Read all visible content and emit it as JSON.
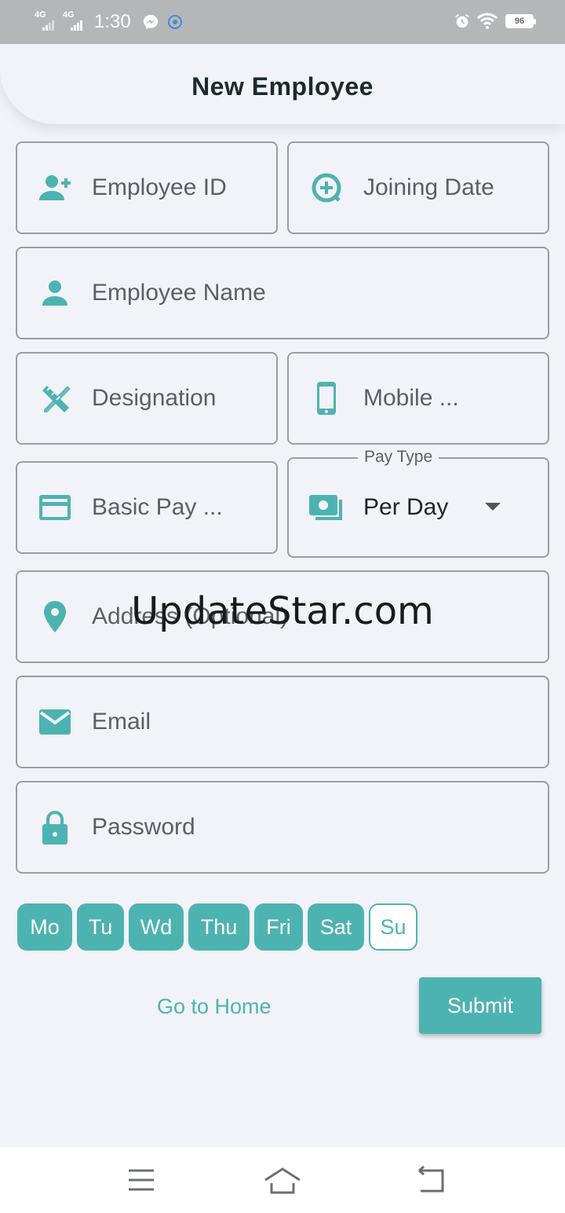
{
  "status_bar": {
    "network1": "4G",
    "network2": "4G",
    "time": "1:30",
    "battery": "96",
    "icons": [
      "messenger-icon",
      "notification-icon",
      "alarm-icon",
      "wifi-icon"
    ]
  },
  "header": {
    "title": "New Employee"
  },
  "fields": {
    "employee_id": {
      "label": "Employee ID",
      "icon": "person-add-icon"
    },
    "joining_date": {
      "label": "Joining Date",
      "icon": "date-add-icon"
    },
    "employee_name": {
      "label": "Employee Name",
      "icon": "person-icon"
    },
    "designation": {
      "label": "Designation",
      "icon": "design-tools-icon"
    },
    "mobile": {
      "label": "Mobile ...",
      "icon": "smartphone-icon"
    },
    "basic_pay": {
      "label": "Basic Pay ...",
      "icon": "credit-card-icon"
    },
    "pay_type": {
      "legend": "Pay Type",
      "value": "Per Day",
      "icon": "money-icon"
    },
    "address": {
      "label": "Address (Optional)",
      "icon": "location-pin-icon"
    },
    "email": {
      "label": "Email",
      "icon": "mail-icon"
    },
    "password": {
      "label": "Password",
      "icon": "lock-icon"
    }
  },
  "watermark": "UpdateStar.com",
  "days": [
    {
      "label": "Mo",
      "selected": true
    },
    {
      "label": "Tu",
      "selected": true
    },
    {
      "label": "Wd",
      "selected": true
    },
    {
      "label": "Thu",
      "selected": true
    },
    {
      "label": "Fri",
      "selected": true
    },
    {
      "label": "Sat",
      "selected": true
    },
    {
      "label": "Su",
      "selected": false
    }
  ],
  "actions": {
    "go_home": "Go to Home",
    "submit": "Submit"
  },
  "colors": {
    "accent": "#4db3b1",
    "background": "#f1f3f9",
    "border": "#9a9ea4"
  }
}
